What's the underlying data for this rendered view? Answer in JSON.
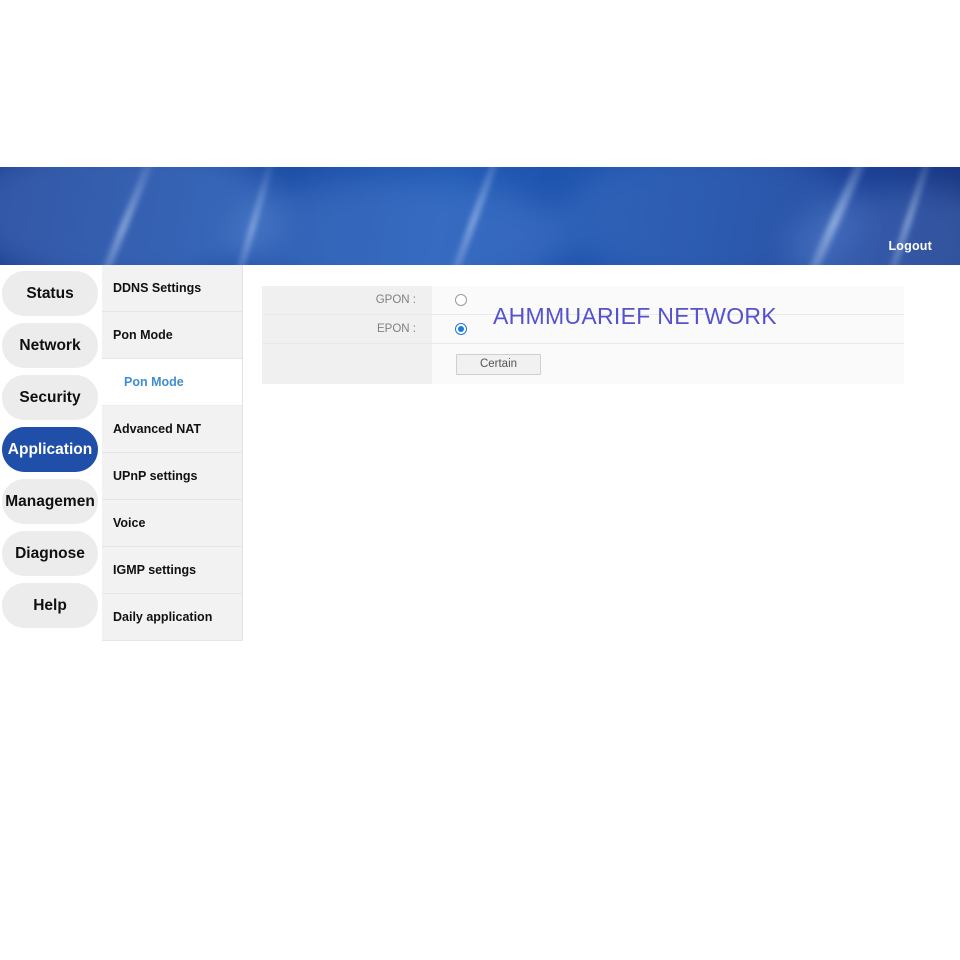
{
  "header": {
    "logout_label": "Logout",
    "banner_color": "#1b49a0"
  },
  "sidebar": {
    "items": [
      {
        "label": "Status",
        "active": false
      },
      {
        "label": "Network",
        "active": false
      },
      {
        "label": "Security",
        "active": false
      },
      {
        "label": "Application",
        "active": true
      },
      {
        "label": "Managemen",
        "active": false
      },
      {
        "label": "Diagnose",
        "active": false
      },
      {
        "label": "Help",
        "active": false
      }
    ],
    "active_color": "#1f4fa8",
    "pill_color": "#ececec"
  },
  "submenu": {
    "items": [
      {
        "label": "DDNS Settings",
        "type": "item",
        "active": false
      },
      {
        "label": "Pon Mode",
        "type": "item",
        "active": false
      },
      {
        "label": "Pon Mode",
        "type": "subitem",
        "active": true
      },
      {
        "label": "Advanced NAT",
        "type": "item",
        "active": false
      },
      {
        "label": "UPnP settings",
        "type": "item",
        "active": false
      },
      {
        "label": "Voice",
        "type": "item",
        "active": false
      },
      {
        "label": "IGMP settings",
        "type": "item",
        "active": false
      },
      {
        "label": "Daily application",
        "type": "item",
        "active": false
      }
    ],
    "active_color": "#3f8ed0"
  },
  "main": {
    "rows": [
      {
        "label": "GPON :",
        "control": "radio",
        "checked": false
      },
      {
        "label": "EPON :",
        "control": "radio",
        "checked": true
      }
    ],
    "submit_label": "Certain"
  },
  "watermark": {
    "text": "AHMMUARIEF NETWORK",
    "color": "#5452cc"
  }
}
